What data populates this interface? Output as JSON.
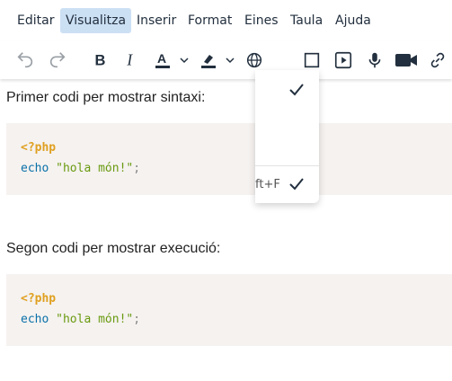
{
  "menubar": {
    "items": [
      {
        "label": "Editar",
        "active": false
      },
      {
        "label": "Visualitza",
        "active": true
      },
      {
        "label": "Inserir",
        "active": false
      },
      {
        "label": "Format",
        "active": false
      },
      {
        "label": "Eines",
        "active": false
      },
      {
        "label": "Taula",
        "active": false
      },
      {
        "label": "Ajuda",
        "active": false
      }
    ]
  },
  "toolbar": {
    "icons": [
      "undo-icon",
      "redo-icon",
      "bold-icon",
      "italic-icon",
      "text-color-icon",
      "chevron-down-icon",
      "highlight-color-icon",
      "chevron-down-icon",
      "language-icon",
      "preview-icon",
      "media-icon",
      "microphone-icon",
      "video-camera-icon",
      "link-icon"
    ],
    "text_color_bar": "#222f3e",
    "highlight_bar": "#222f3e"
  },
  "content": {
    "para1": "Primer codi per mostrar sintaxi:",
    "code1": {
      "line1": "<?php",
      "kw": "echo",
      "str": "\"hola món!\"",
      "punc": ";"
    },
    "para2": "Segon codi per mostrar execució:",
    "code2": {
      "line1": "<?php",
      "kw": "echo",
      "str": "\"hola món!\"",
      "punc": ";"
    }
  },
  "dropdown": {
    "shortcut": "ft+F",
    "items_checked": [
      true,
      true
    ]
  }
}
